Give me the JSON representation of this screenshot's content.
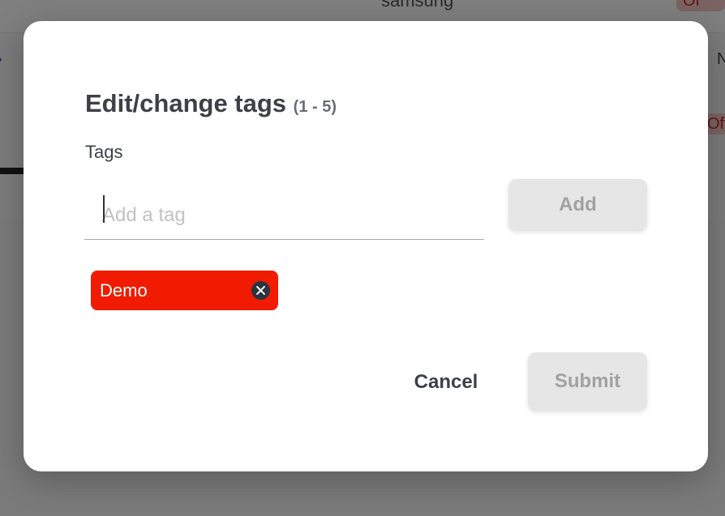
{
  "background": {
    "brand_text": "samsung",
    "status_badge_1": "Of",
    "status_badge_2": "Of",
    "right_edge_char": "N"
  },
  "dialog": {
    "title": "Edit/change tags",
    "title_range": "(1 - 5)",
    "tags_label": "Tags",
    "tag_input": {
      "value": "",
      "placeholder": "Add a tag"
    },
    "add_button": "Add",
    "tags": [
      {
        "label": "Demo",
        "color": "#f01b00"
      }
    ],
    "cancel_button": "Cancel",
    "submit_button": "Submit"
  },
  "icons": {
    "tag_remove": "close-circle-icon"
  }
}
